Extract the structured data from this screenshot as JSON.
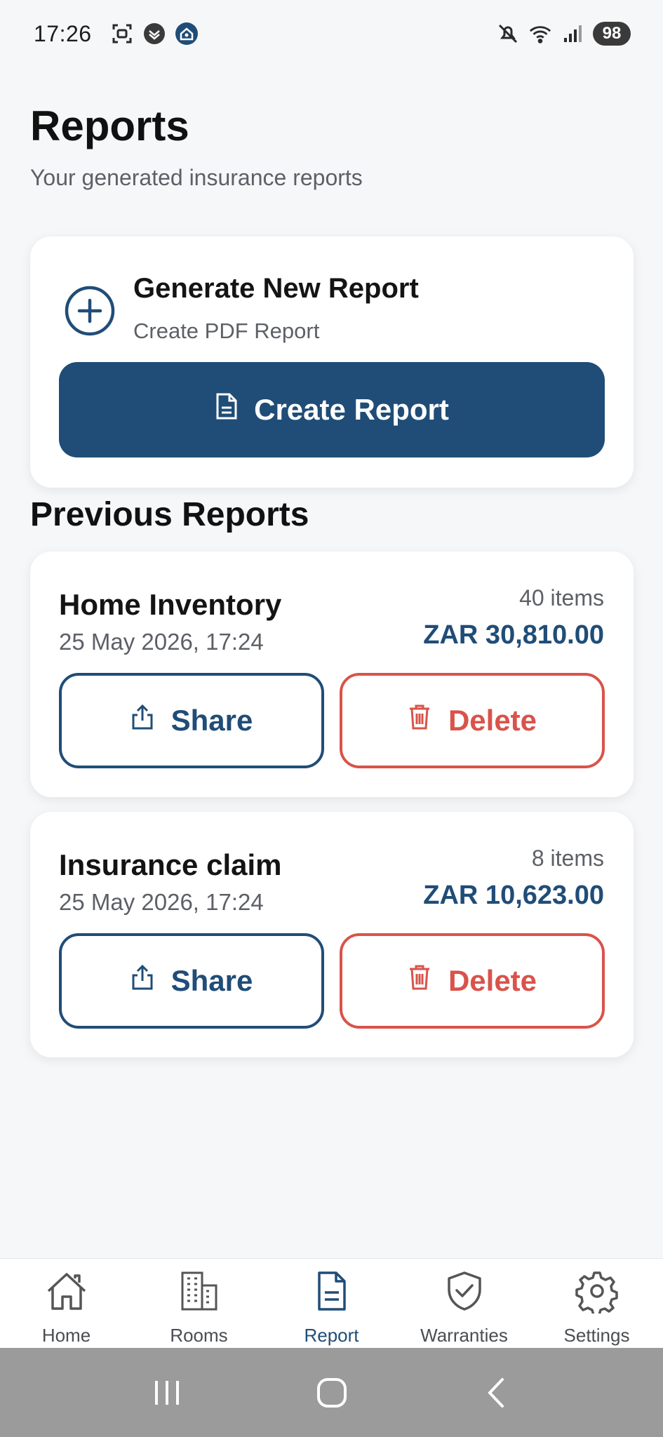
{
  "status_bar": {
    "time": "17:26",
    "battery": "98",
    "icons": [
      "screenshot-icon",
      "shield-check-icon",
      "home-app-icon",
      "mute-icon",
      "wifi-icon",
      "signal-icon"
    ]
  },
  "header": {
    "title": "Reports",
    "subtitle": "Your generated insurance reports"
  },
  "generate": {
    "title": "Generate New Report",
    "subtitle": "Create PDF Report",
    "button_label": "Create Report",
    "icon": "plus-circle-icon"
  },
  "previous": {
    "title": "Previous Reports",
    "reports": [
      {
        "name": "Home Inventory",
        "date": "25 May 2026, 17:24",
        "count": "40 items",
        "total": "ZAR 30,810.00",
        "share_label": "Share",
        "delete_label": "Delete"
      },
      {
        "name": "Insurance claim",
        "date": "25 May 2026, 17:24",
        "count": "8 items",
        "total": "ZAR 10,623.00",
        "share_label": "Share",
        "delete_label": "Delete"
      }
    ]
  },
  "nav": {
    "items": [
      {
        "label": "Home",
        "icon": "house-icon"
      },
      {
        "label": "Rooms",
        "icon": "building-icon"
      },
      {
        "label": "Report",
        "icon": "document-icon",
        "active": true
      },
      {
        "label": "Warranties",
        "icon": "shield-check-icon"
      },
      {
        "label": "Settings",
        "icon": "gear-icon"
      }
    ]
  },
  "colors": {
    "primary": "#204d77",
    "danger": "#d9534a",
    "background": "#f6f7f9"
  }
}
